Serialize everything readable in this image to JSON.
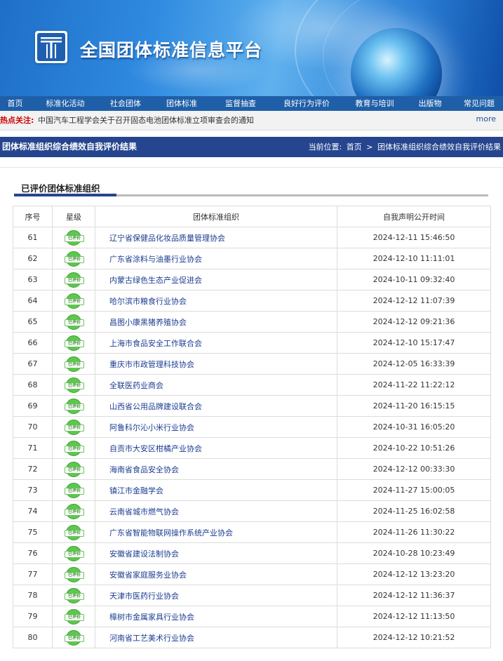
{
  "site": {
    "title": "全国团体标准信息平台"
  },
  "nav": [
    {
      "label": "首页",
      "w": 43
    },
    {
      "label": "标准化活动",
      "w": 100
    },
    {
      "label": "社会团体",
      "w": 72
    },
    {
      "label": "团体标准",
      "w": 88
    },
    {
      "label": "监督抽查",
      "w": 80
    },
    {
      "label": "良好行为评价",
      "w": 108
    },
    {
      "label": "教育与培训",
      "w": 86
    },
    {
      "label": "出版物",
      "w": 72
    },
    {
      "label": "常见问题",
      "w": 68
    }
  ],
  "hot": {
    "label": "热点关注:",
    "text": "中国汽车工程学会关于召开固态电池团体标准立项审查会的通知",
    "more": "more"
  },
  "section": {
    "title": "团体标准组织综合绩效自我评价结果",
    "crumb_prefix": "当前位置:",
    "crumb_home": "首页",
    "crumb_sep": ">",
    "crumb_current": "团体标准组织综合绩效自我评价结果"
  },
  "sub_title": "已评价团体标准组织",
  "table": {
    "headers": [
      "序号",
      "星级",
      "团体标准组织",
      "自我声明公开时间"
    ],
    "badge_text": "已评价",
    "rows": [
      {
        "no": "61",
        "org": "辽宁省保健品化妆品质量管理协会",
        "time": "2024-12-11 15:46:50"
      },
      {
        "no": "62",
        "org": "广东省涂料与油墨行业协会",
        "time": "2024-12-10 11:11:01"
      },
      {
        "no": "63",
        "org": "内蒙古绿色生态产业促进会",
        "time": "2024-10-11 09:32:40"
      },
      {
        "no": "64",
        "org": "哈尔滨市粮食行业协会",
        "time": "2024-12-12 11:07:39"
      },
      {
        "no": "65",
        "org": "昌图小康黑猪养殖协会",
        "time": "2024-12-12 09:21:36"
      },
      {
        "no": "66",
        "org": "上海市食品安全工作联合会",
        "time": "2024-12-10 15:17:47"
      },
      {
        "no": "67",
        "org": "重庆市市政管理科技协会",
        "time": "2024-12-05 16:33:39"
      },
      {
        "no": "68",
        "org": "全联医药业商会",
        "time": "2024-11-22 11:22:12"
      },
      {
        "no": "69",
        "org": "山西省公用品牌建设联合会",
        "time": "2024-11-20 16:15:15"
      },
      {
        "no": "70",
        "org": "阿鲁科尔沁小米行业协会",
        "time": "2024-10-31 16:05:20"
      },
      {
        "no": "71",
        "org": "自贡市大安区柑橘产业协会",
        "time": "2024-10-22 10:51:26"
      },
      {
        "no": "72",
        "org": "海南省食品安全协会",
        "time": "2024-12-12 00:33:30"
      },
      {
        "no": "73",
        "org": "镇江市金融学会",
        "time": "2024-11-27 15:00:05"
      },
      {
        "no": "74",
        "org": "云南省城市燃气协会",
        "time": "2024-11-25 16:02:58"
      },
      {
        "no": "75",
        "org": "广东省智能物联网操作系统产业协会",
        "time": "2024-11-26 11:30:22"
      },
      {
        "no": "76",
        "org": "安徽省建设法制协会",
        "time": "2024-10-28 10:23:49"
      },
      {
        "no": "77",
        "org": "安徽省家庭服务业协会",
        "time": "2024-12-12 13:23:20"
      },
      {
        "no": "78",
        "org": "天津市医药行业协会",
        "time": "2024-12-12 11:36:37"
      },
      {
        "no": "79",
        "org": "樟树市金属家具行业协会",
        "time": "2024-12-12 11:13:50"
      },
      {
        "no": "80",
        "org": "河南省工艺美术行业协会",
        "time": "2024-12-12 10:21:52"
      }
    ]
  }
}
